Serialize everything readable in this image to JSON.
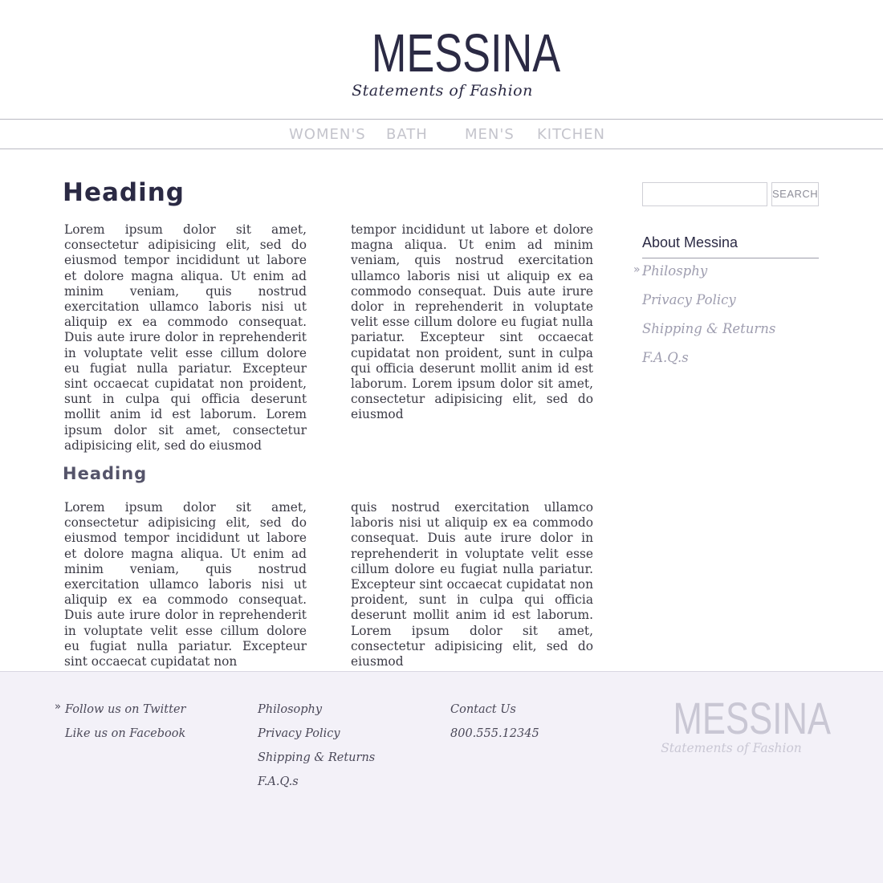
{
  "header": {
    "logo_word": "MESSINA",
    "logo_tagline": "Statements of Fashion"
  },
  "nav": {
    "items": [
      "WOMEN'S",
      "BATH",
      "MEN'S",
      "KITCHEN"
    ]
  },
  "main": {
    "heading1": "Heading",
    "section1": {
      "col1": "Lorem ipsum dolor sit amet, consectetur adipisicing elit, sed do eiusmod tempor incididunt ut labore et dolore magna aliqua. Ut enim ad minim veniam, quis nostrud exercitation ullamco laboris nisi ut aliquip ex ea commodo consequat. Duis aute irure dolor in reprehenderit in voluptate velit esse cillum dolore eu fugiat nulla pariatur. Excepteur sint occaecat cupidatat non proident, sunt in culpa qui officia deserunt mollit anim id est laborum. Lorem ipsum dolor sit amet, consectetur adipisicing elit, sed do eiusmod",
      "col2": "tempor incididunt ut labore et dolore magna aliqua. Ut enim ad minim veniam, quis nostrud exercitation ullamco laboris nisi ut aliquip ex ea commodo consequat. Duis aute irure dolor in reprehenderit in voluptate velit esse cillum dolore eu fugiat nulla pariatur. Excepteur sint occaecat cupidatat non proident, sunt in culpa qui officia deserunt mollit anim id est laborum. Lorem ipsum dolor sit amet, consectetur adipisicing elit, sed do eiusmod"
    },
    "heading2": "Heading",
    "section2": {
      "col1": "Lorem ipsum dolor sit amet, consectetur adipisicing elit, sed do eiusmod tempor incididunt ut labore et dolore magna aliqua. Ut enim ad minim veniam, quis nostrud exercitation ullamco laboris nisi ut aliquip ex ea commodo consequat. Duis aute irure dolor in reprehenderit in voluptate velit esse cillum dolore eu fugiat nulla pariatur. Excepteur sint occaecat cupidatat non",
      "col2": "quis nostrud exercitation ullamco laboris nisi ut aliquip ex ea commodo consequat. Duis aute irure dolor in reprehenderit in voluptate velit esse cillum dolore eu fugiat nulla pariatur. Excepteur sint occaecat cupidatat non proident, sunt in culpa qui officia deserunt mollit anim id est laborum. Lorem ipsum dolor sit amet, consectetur adipisicing elit, sed do eiusmod"
    }
  },
  "sidebar": {
    "search": {
      "value": "",
      "button_label": "SEARCH"
    },
    "title": "About Messina",
    "arrow": "»",
    "items": [
      "Philosphy",
      "Privacy Policy",
      "Shipping & Returns",
      "F.A.Q.s"
    ]
  },
  "footer": {
    "arrow": "»",
    "social": [
      "Follow us on Twitter",
      "Like us on Facebook"
    ],
    "links": [
      "Philosophy",
      "Privacy Policy",
      "Shipping & Returns",
      "F.A.Q.s"
    ],
    "contact_label": "Contact Us",
    "phone": "800.555.12345",
    "logo_word": "MESSINA",
    "logo_tagline": "Statements of Fashion"
  },
  "colors": {
    "brand": "#2b2a44",
    "muted": "#c4c4cc",
    "footer_bg": "#f3f1f8"
  }
}
